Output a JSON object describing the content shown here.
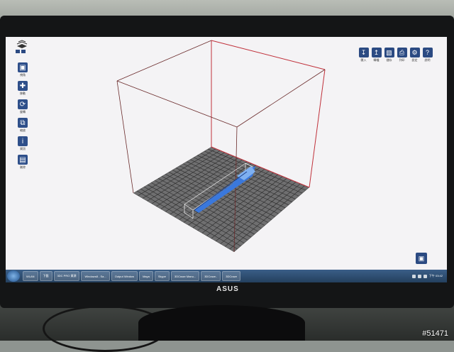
{
  "app": {
    "left_tools": [
      {
        "icon": "cube-view-icon",
        "label": "視角"
      },
      {
        "icon": "move-icon",
        "label": "移動"
      },
      {
        "icon": "rotate-icon",
        "label": "旋轉"
      },
      {
        "icon": "scale-icon",
        "label": "縮放"
      },
      {
        "icon": "info-icon",
        "label": "資訊"
      },
      {
        "icon": "trash-icon",
        "label": "刪除"
      }
    ],
    "right_tools": [
      {
        "icon": "import-icon",
        "label": "匯入"
      },
      {
        "icon": "export-icon",
        "label": "轉檔"
      },
      {
        "icon": "save-icon",
        "label": "儲存"
      },
      {
        "icon": "print-icon",
        "label": "列印"
      },
      {
        "icon": "settings-icon",
        "label": "設定"
      },
      {
        "icon": "help-icon",
        "label": "說明"
      }
    ]
  },
  "taskbar": {
    "tasks": [
      "WLAN",
      "下載",
      "3DC PRO 資源",
      "Windows8 - Sa...",
      "Output Window",
      "Maya",
      "Skype",
      "3DCraze Manu...",
      "3DCraze..",
      "3DCraze"
    ],
    "clock": "下午 03:42"
  },
  "monitor": {
    "brand": "ASUS"
  },
  "watermark": "#51471",
  "colors": {
    "accent": "#2b4a82",
    "box_red": "#c0303a",
    "bed": "#727273",
    "model": "#3b7de0"
  }
}
